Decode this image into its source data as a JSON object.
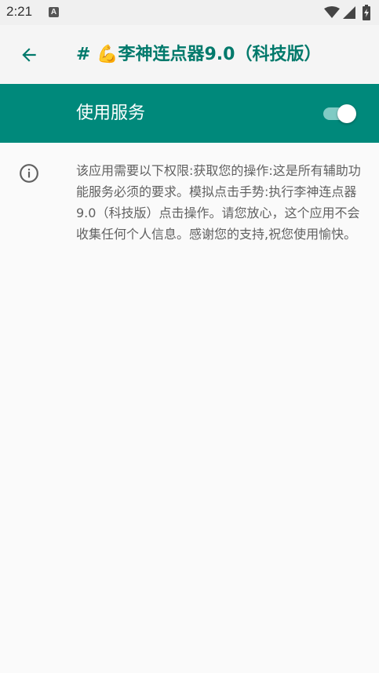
{
  "status_bar": {
    "time": "2:21",
    "notification_icon_letter": "A",
    "icons": [
      "wifi-icon",
      "signal-icon",
      "battery-charging-icon"
    ]
  },
  "toolbar": {
    "back_icon": "arrow-back-icon",
    "title": "# 💪李神连点器9.0（科技版）"
  },
  "service": {
    "label": "使用服务",
    "enabled": true
  },
  "info": {
    "icon": "info-icon",
    "description": "该应用需要以下权限:获取您的操作:这是所有辅助功能服务必须的要求。模拟点击手势:执行李神连点器9.0（科技版）点击操作。请您放心，这个应用不会收集任何个人信息。感谢您的支持,祝您使用愉快。"
  },
  "colors": {
    "accent": "#00796b",
    "bar": "#00897b",
    "track": "#80cbc4"
  }
}
